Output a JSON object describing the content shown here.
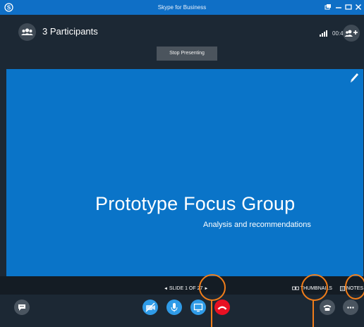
{
  "titlebar": {
    "title": "Skype for Business",
    "logo_icon": "skype-logo-icon",
    "buttons": [
      "popout-icon",
      "minimize-icon",
      "maximize-icon",
      "close-icon"
    ]
  },
  "header": {
    "participants_label": "3 Participants",
    "timer": "00:45",
    "stop_presenting_label": "Stop Presenting"
  },
  "slide": {
    "title": "Prototype Focus Group",
    "subtitle": "Analysis and recommendations",
    "background_color": "#0a74c8"
  },
  "slide_nav": {
    "counter": "SLIDE 1 OF 27",
    "prev_arrow": "◄",
    "next_arrow": "►",
    "thumbnails_label": "THUMBNAILS",
    "notes_label": "NOTES"
  },
  "controls": {
    "buttons": [
      "chat-icon",
      "video-off-icon",
      "microphone-icon",
      "present-screen-icon",
      "hang-up-icon",
      "call-controls-icon",
      "more-options-icon"
    ]
  },
  "colors": {
    "titlebar": "#0f6fc6",
    "accent": "#2f9be7",
    "hangup": "#e81123",
    "highlight": "#f07d1a"
  }
}
